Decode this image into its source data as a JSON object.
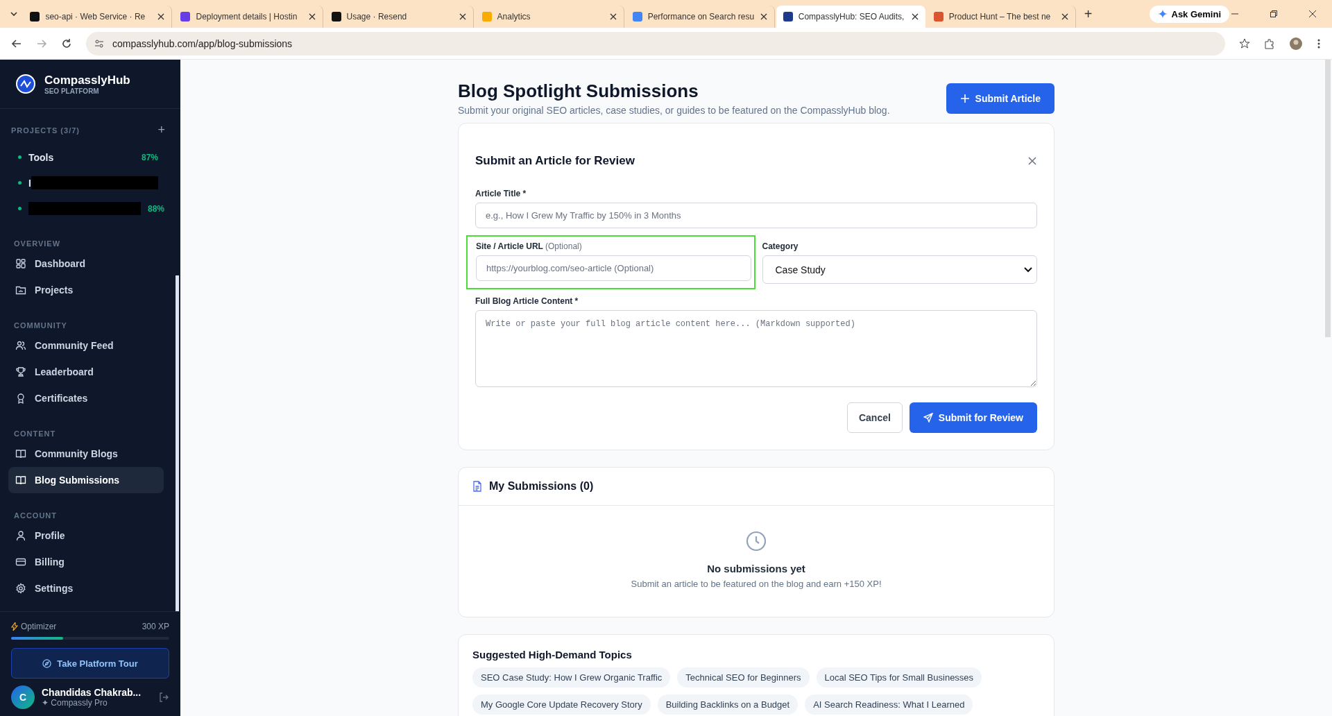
{
  "browser": {
    "tabs": [
      {
        "title": "seo-api · Web Service · Re",
        "selected": false,
        "color": "#111111"
      },
      {
        "title": "Deployment details | Hostin",
        "selected": false,
        "color": "#673de6"
      },
      {
        "title": "Usage · Resend",
        "selected": false,
        "color": "#111111"
      },
      {
        "title": "Analytics",
        "selected": false,
        "color": "#f9ab00"
      },
      {
        "title": "Performance on Search resu",
        "selected": false,
        "color": "#4285f4"
      },
      {
        "title": "CompasslyHub: SEO Audits,",
        "selected": true,
        "color": "#1e3a8a"
      },
      {
        "title": "Product Hunt – The best ne",
        "selected": false,
        "color": "#da552f"
      }
    ],
    "new_tab": "+",
    "gemini": "Ask Gemini",
    "url": "compasslyhub.com/app/blog-submissions"
  },
  "sidebar": {
    "brand": "CompasslyHub",
    "tagline": "SEO PLATFORM",
    "projects_heading": "PROJECTS (3/7)",
    "add": "+",
    "projects": [
      {
        "kind": "project",
        "name": "Tools",
        "score": "87%"
      },
      {
        "kind": "redacted",
        "name": "I"
      },
      {
        "kind": "redacted",
        "score": "88%"
      }
    ],
    "sections": [
      {
        "heading": "OVERVIEW",
        "items": [
          {
            "label": "Dashboard",
            "selected": false
          },
          {
            "label": "Projects",
            "selected": false
          }
        ]
      },
      {
        "heading": "COMMUNITY",
        "items": [
          {
            "label": "Community Feed",
            "selected": false
          },
          {
            "label": "Leaderboard",
            "selected": false
          },
          {
            "label": "Certificates",
            "selected": false
          }
        ]
      },
      {
        "heading": "CONTENT",
        "items": [
          {
            "label": "Community Blogs",
            "selected": false
          },
          {
            "label": "Blog Submissions",
            "selected": true
          }
        ]
      },
      {
        "heading": "ACCOUNT",
        "items": [
          {
            "label": "Profile",
            "selected": false
          },
          {
            "label": "Billing",
            "selected": false
          },
          {
            "label": "Settings",
            "selected": false
          }
        ]
      }
    ],
    "rank": "Optimizer",
    "xp": "300 XP",
    "level": 0.33,
    "tour": "Take Platform Tour",
    "user": {
      "initial": "C",
      "name": "Chandidas Chakrab...",
      "plan": "✦ Compassly Pro"
    }
  },
  "page": {
    "title": "Blog Spotlight Submissions",
    "subtitle": "Submit your original SEO articles, case studies, or guides to be featured on the CompasslyHub blog.",
    "submit": "Submit Article"
  },
  "form": {
    "title": "Submit an Article for Review",
    "article_title": {
      "label": "Article Title *",
      "placeholder": "e.g., How I Grew My Traffic by 150% in 3 Months"
    },
    "url": {
      "label": "Site / Article URL",
      "hint": "(Optional)",
      "placeholder": "https://yourblog.com/seo-article (Optional)",
      "highlighted": true
    },
    "category": {
      "label": "Category",
      "value": "Case Study"
    },
    "content": {
      "label": "Full Blog Article Content *",
      "placeholder": "Write or paste your full blog article content here... (Markdown supported)"
    },
    "cancel": "Cancel",
    "submit": "Submit for Review"
  },
  "submissions": {
    "title": "My Submissions (0)",
    "empty_title": "No submissions yet",
    "empty_text": "Submit an article to be featured on the blog and earn +150 XP!"
  },
  "topics": {
    "title": "Suggested High-Demand Topics",
    "items": [
      "SEO Case Study: How I Grew Organic Traffic",
      "Technical SEO for Beginners",
      "Local SEO Tips for Small Businesses",
      "My Google Core Update Recovery Story",
      "Building Backlinks on a Budget",
      "AI Search Readiness: What I Learned"
    ]
  }
}
